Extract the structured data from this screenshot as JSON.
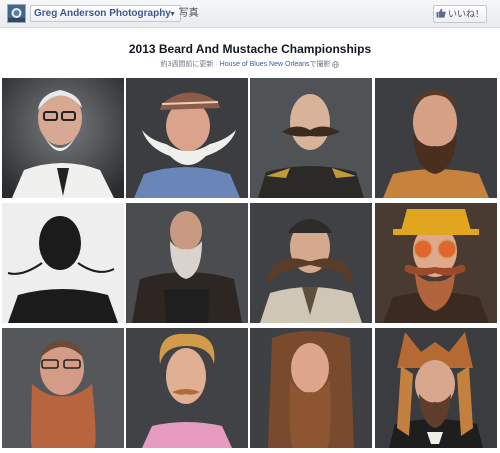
{
  "header": {
    "page_name": "Greg Anderson Photography",
    "page_tab": "写真",
    "like_label": "いいね！"
  },
  "album": {
    "title": "2013 Beard And Mustache Championships",
    "meta_before": "約3週間前に更新 · ",
    "venue": "House of Blues New Orleans",
    "meta_after": "で撮影"
  },
  "colors": {
    "brand": "#3b5998",
    "bar": "#e9ebee"
  },
  "icons": {
    "avatar": "page-avatar-icon",
    "dropdown": "chevron-down-icon",
    "like": "thumbs-up-icon",
    "globe": "globe-icon"
  }
}
